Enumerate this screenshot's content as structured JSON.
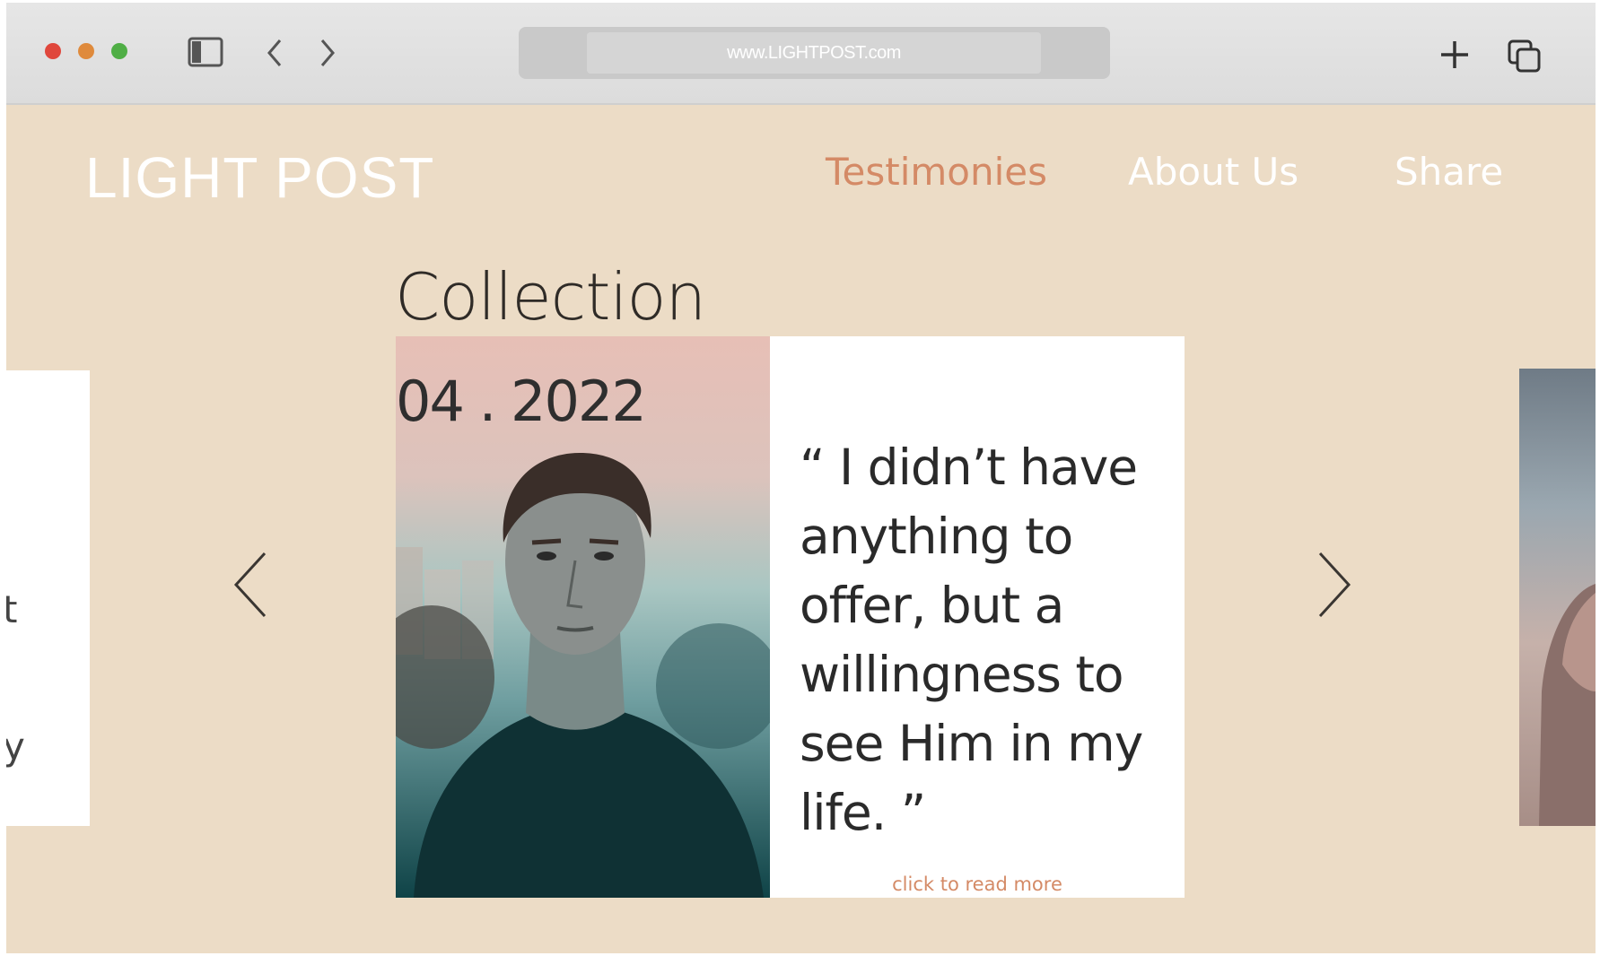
{
  "browser": {
    "url": "www.LIGHTPOST.com",
    "icons": [
      "close-dot",
      "minimize-dot",
      "zoom-dot",
      "sidebar-icon",
      "back-chevron-icon",
      "forward-chevron-icon",
      "plus-icon",
      "tabs-icon"
    ]
  },
  "site": {
    "brand": "LIGHT POST",
    "nav": [
      {
        "label": "Testimonies",
        "active": true
      },
      {
        "label": "About Us",
        "active": false
      },
      {
        "label": "Share",
        "active": false
      }
    ]
  },
  "collection": {
    "title": "Collection",
    "card": {
      "date": "04 . 2022",
      "quote": "“ I didn’t have anything to offer, but a willingness to see Him in my life. ”",
      "cta": "click to read more"
    },
    "left_card_fragments": [
      "t",
      "y"
    ]
  },
  "colors": {
    "background": "#ecdcc6",
    "accent": "#d48a66",
    "text": "#2f2b27"
  }
}
